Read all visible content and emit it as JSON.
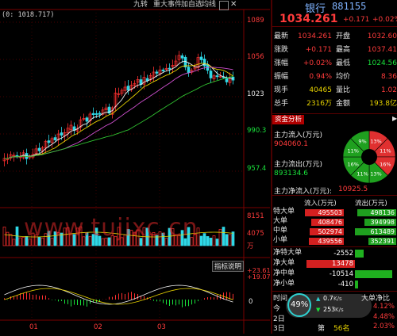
{
  "toolbar": {
    "info": "(0: 1018.717)",
    "buttons": [
      "九转",
      "重大事件",
      "加自选",
      "均线"
    ]
  },
  "price_axis": [
    "1089",
    "1056",
    "1023",
    "990.3",
    "957.4"
  ],
  "volume_axis": [
    "8151",
    "4075",
    "万"
  ],
  "indicator": {
    "title": "指标说明",
    "axis": [
      "+23.61",
      "+19.07",
      "0"
    ]
  },
  "time_axis": [
    "01",
    "02",
    "03"
  ],
  "watermark": "www.tujixc.cn",
  "quote": {
    "name": "银行",
    "code": "881155",
    "price": "1034.261",
    "change": "+0.171",
    "change_pct": "+0.02%",
    "rows": [
      {
        "l1": "最新",
        "v1": "1034.261",
        "l2": "开盘",
        "v2": "1032.60"
      },
      {
        "l1": "涨跌",
        "v1": "+0.171",
        "l2": "最高",
        "v2": "1037.41"
      },
      {
        "l1": "涨幅",
        "v1": "+0.02%",
        "l2": "最低",
        "v2": "1024.56"
      },
      {
        "l1": "振幅",
        "v1": "0.94%",
        "l2": "均价",
        "v2": "8.36"
      },
      {
        "l1": "现手",
        "v1": "40465",
        "l2": "量比",
        "v2": "1.02"
      },
      {
        "l1": "总手",
        "v1": "2316万",
        "l2": "金额",
        "v2": "193.8亿"
      }
    ]
  },
  "capital": {
    "tab": "资金分析",
    "inflow_label": "主力流入(万元)",
    "inflow_value": "904060.1",
    "outflow_label": "主力流出(万元)",
    "outflow_value": "893134.6",
    "net_label": "主力净流入(万元):",
    "net_value": "10925.5",
    "pie": [
      {
        "label": "13%",
        "color": "#e03030"
      },
      {
        "label": "11%",
        "color": "#e03030"
      },
      {
        "label": "16%",
        "color": "#e03030"
      },
      {
        "label": "13%",
        "color": "#1fa01f"
      },
      {
        "label": "11%",
        "color": "#1fa01f"
      },
      {
        "label": "16%",
        "color": "#1fa01f"
      },
      {
        "label": "11%",
        "color": "#1fa01f"
      },
      {
        "label": "9%",
        "color": "#1fa01f"
      }
    ]
  },
  "flow_table": {
    "headers": [
      "流入(万元)",
      "流出(万元)"
    ],
    "rows": [
      {
        "label": "特大单",
        "in": "495503",
        "out": "498136",
        "in_frac": 0.95,
        "out_frac": 0.95
      },
      {
        "label": "大单",
        "in": "408476",
        "out": "394998",
        "in_frac": 0.78,
        "out_frac": 0.76
      },
      {
        "label": "中单",
        "in": "502974",
        "out": "613489",
        "in_frac": 0.82,
        "out_frac": 1.0
      },
      {
        "label": "小单",
        "in": "439556",
        "out": "352391",
        "in_frac": 0.85,
        "out_frac": 0.68
      }
    ]
  },
  "net_flows": [
    {
      "label": "净特大单",
      "value": "-2552",
      "frac": 0.15
    },
    {
      "label": "净大单",
      "value": "13478",
      "frac": 0.85
    },
    {
      "label": "净中单",
      "value": "-10514",
      "frac": 0.65
    },
    {
      "label": "净小单",
      "value": "-410",
      "frac": 0.05
    }
  ],
  "bottom": {
    "time_label": "时间",
    "progress_pct": "49%",
    "speed_up": "0.7",
    "speed_up_unit": "K/s",
    "speed_down": "253",
    "speed_down_unit": "K/s",
    "rank_items": [
      {
        "day": "今",
        "rank": ""
      },
      {
        "day": "2日",
        "rank": ""
      },
      {
        "day": "3日",
        "rank": "56名"
      }
    ],
    "rank_prefix": "第",
    "big_net_title": "大单净比",
    "big_net": [
      "4.12%",
      "4.48%",
      "2.03%"
    ]
  }
}
